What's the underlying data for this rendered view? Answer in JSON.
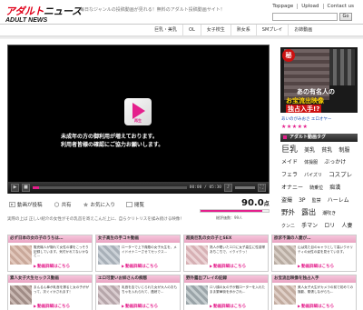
{
  "site": {
    "logo_main_1": "アダルト",
    "logo_main_2": "ニュース",
    "logo_sub": "ADULT NEWS",
    "tagline": "毎日なジャンルの投稿動画が見れる！無料のアダルト投稿動画サイト！"
  },
  "topnav": [
    "Toppage",
    "Upload",
    "Contact us"
  ],
  "search": {
    "value": "",
    "button": "Go"
  },
  "categories": [
    "巨乳・美乳",
    "OL",
    "女子校生",
    "熟女系",
    "SMプレイ",
    "お姉動画"
  ],
  "player": {
    "play_label": "再生",
    "notice_line1": "未成年の方の御利用が増えております。",
    "notice_line2": "利用者皆様の確認にご協力お願いします。",
    "time": "00:00 / 05:30",
    "progress": 0.04
  },
  "actions": {
    "report": "動画が投稿",
    "share": "共有",
    "favorite": "お気に入り",
    "fav_extra": "閲覧",
    "score": "90.0",
    "score_unit": "点",
    "score_fraction": 0.9,
    "vote_count": "総評価数：99人",
    "description": "実際の上ば 正しい紹介の女性がその乳首を寄えこんだ上に、自らクリトリスを揉み続ける映像！"
  },
  "sidebar": {
    "ad_badge": "秘",
    "ad_line1": "あの有名人の",
    "ad_line2": "お宝流出映像",
    "ad_line3": "独占入手!?",
    "ad_caption": "あいのがみおさ エロオヤー",
    "stars": "★★★★★",
    "tags_title": "アダルト動画タグ",
    "tags": [
      {
        "t": "巨乳",
        "s": 9
      },
      {
        "t": "美乳",
        "s": 6
      },
      {
        "t": "貧乳",
        "s": 6
      },
      {
        "t": "制服",
        "s": 6
      },
      {
        "t": "メイド",
        "s": 6
      },
      {
        "t": "体操服",
        "s": 5
      },
      {
        "t": "ぶっかけ",
        "s": 6
      },
      {
        "t": "フェラ",
        "s": 6
      },
      {
        "t": "パイズリ",
        "s": 5
      },
      {
        "t": "コスプレ",
        "s": 6.5
      },
      {
        "t": "オナニー",
        "s": 6
      },
      {
        "t": "騎乗位",
        "s": 5
      },
      {
        "t": "痴漢",
        "s": 6
      },
      {
        "t": "盗撮",
        "s": 6
      },
      {
        "t": "3P",
        "s": 6
      },
      {
        "t": "監禁",
        "s": 5
      },
      {
        "t": "ハーレム",
        "s": 6
      },
      {
        "t": "野外",
        "s": 7.5
      },
      {
        "t": "露出",
        "s": 8
      },
      {
        "t": "潮吹き",
        "s": 5
      },
      {
        "t": "クンニ",
        "s": 5
      },
      {
        "t": "手マン",
        "s": 6
      },
      {
        "t": "ロリ",
        "s": 6
      },
      {
        "t": "人妻",
        "s": 6
      },
      {
        "t": "女子大生",
        "s": 5
      },
      {
        "t": "レズ",
        "s": 6
      },
      {
        "t": "複数プレイ",
        "s": 7.5
      },
      {
        "t": "素人",
        "s": 6
      },
      {
        "t": "SM",
        "s": 6
      },
      {
        "t": "アクメ",
        "s": 5
      },
      {
        "t": "アダルト",
        "s": 5
      }
    ]
  },
  "cards": [
    {
      "head": "必ず日本の女の子のうちは…",
      "text": "販売機人が隠れて女性の裸をこっそり記録しています。気付かれてないかなと…",
      "link": "動画詳細はこちら",
      "c1": "#c9a89a",
      "c2": "#e2c8bc"
    },
    {
      "head": "女子高生の手コキ動画",
      "text": "ローターで上下貴殿の女子大生を、メイドオナニーさせてセックス…",
      "link": "動画詳細はこちら",
      "c1": "#a8b0b8",
      "c2": "#ccd2d8"
    },
    {
      "head": "超美巨乳の女の子とSEX",
      "text": "熟人が着いたエロに女子高生に性感帯あちこちで、イクイクっ！",
      "link": "動画詳細はこちら",
      "c1": "#d6b0b4",
      "c2": "#ecd4d6"
    },
    {
      "head": "欲求不満の人妻が…",
      "text": "山は見た目のキャラとして高いクオリティの女性の姿を見せています。",
      "link": "動画詳細はこちら",
      "c1": "#b8aca2",
      "c2": "#d8cec6"
    },
    {
      "head": "素人女子大生セックス動画",
      "text": "まんるん拳が乳首を擦ると女の子ががって、次ぐイかされます！",
      "link": "動画詳細はこちら",
      "c1": "#a08c86",
      "c2": "#cbbab4"
    },
    {
      "head": "エロ可愛いお姉さんの痴態",
      "text": "乳首を舌でいじられた女が大人のおもちゃを入れられて、連続で…",
      "link": "動画詳細はこちら",
      "c1": "#b6a6aa",
      "c2": "#dacdd0"
    },
    {
      "head": "野外露出プレイの記録",
      "text": "ロリ顔の女の子が膣ローターを入れたまま繁華街を歩かされ…",
      "link": "動画詳細はこちら",
      "c1": "#9aa4a8",
      "c2": "#c6ced0"
    },
    {
      "head": "お宝流出映像を独占入手",
      "text": "美人女子大生がカメラの前で初めての撮影、緊張しながらも…",
      "link": "動画詳細はこちら",
      "c1": "#c2aca0",
      "c2": "#e0d0c8"
    }
  ]
}
